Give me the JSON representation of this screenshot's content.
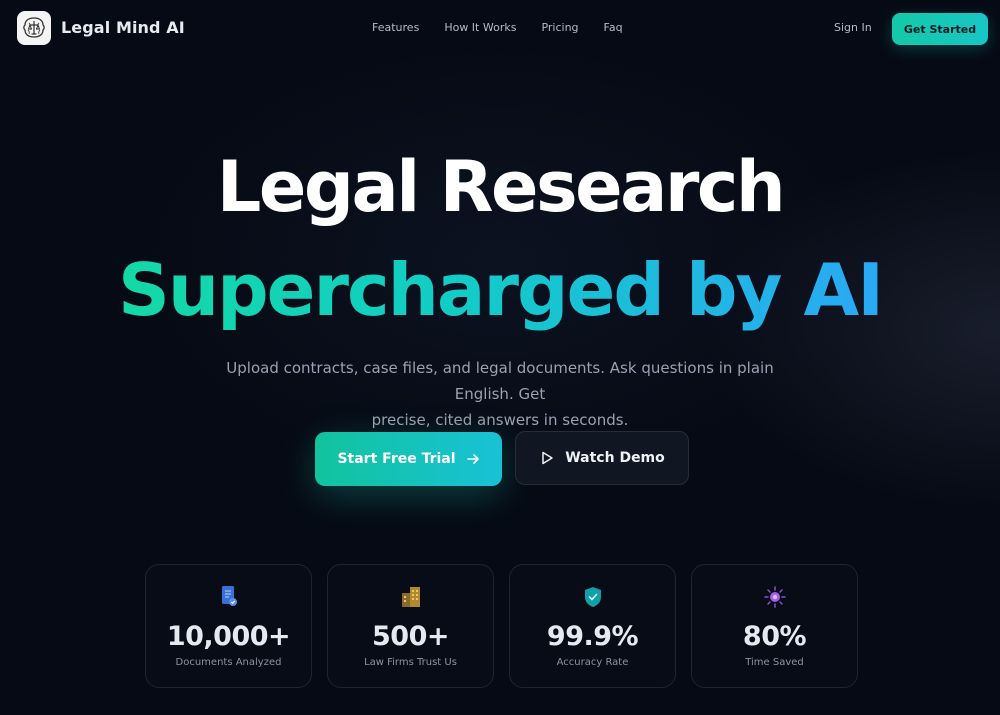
{
  "nav": {
    "brand": "Legal Mind AI",
    "links": [
      "Features",
      "How It Works",
      "Pricing",
      "Faq"
    ],
    "sign_in": "Sign In",
    "get_started": "Get Started"
  },
  "hero": {
    "title_line1": "Legal Research",
    "title_line2": "Supercharged by AI",
    "subtitle_line1": "Upload contracts, case files, and legal documents. Ask questions in plain English. Get",
    "subtitle_line2": "precise, cited answers in seconds.",
    "primary_cta": "Start Free Trial",
    "secondary_cta": "Watch Demo"
  },
  "stats": [
    {
      "icon": "document-icon",
      "value": "10,000+",
      "label": "Documents Analyzed"
    },
    {
      "icon": "building-icon",
      "value": "500+",
      "label": "Law Firms Trust Us"
    },
    {
      "icon": "shield-check-icon",
      "value": "99.9%",
      "label": "Accuracy Rate"
    },
    {
      "icon": "sparkle-icon",
      "value": "80%",
      "label": "Time Saved"
    }
  ],
  "colors": {
    "background": "#060a14",
    "accent_teal": "#14c9a8",
    "accent_blue": "#2aa8f6"
  }
}
